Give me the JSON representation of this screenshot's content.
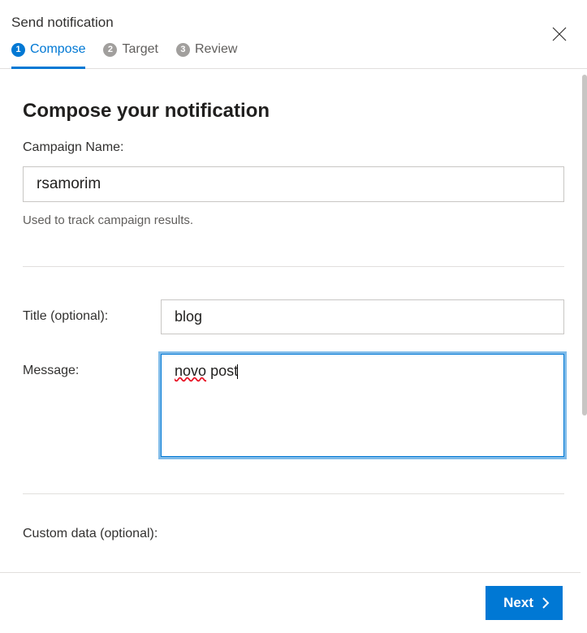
{
  "header": {
    "title": "Send notification"
  },
  "wizard": {
    "steps": [
      {
        "num": "1",
        "label": "Compose"
      },
      {
        "num": "2",
        "label": "Target"
      },
      {
        "num": "3",
        "label": "Review"
      }
    ]
  },
  "compose": {
    "heading": "Compose your notification",
    "campaign": {
      "label": "Campaign Name:",
      "value": "rsamorim",
      "helper": "Used to track campaign results."
    },
    "title": {
      "label": "Title (optional):",
      "value": "blog"
    },
    "message": {
      "label": "Message:",
      "word1": "novo",
      "word2": "post"
    },
    "custom": {
      "label": "Custom data (optional):"
    }
  },
  "footer": {
    "next": "Next"
  }
}
